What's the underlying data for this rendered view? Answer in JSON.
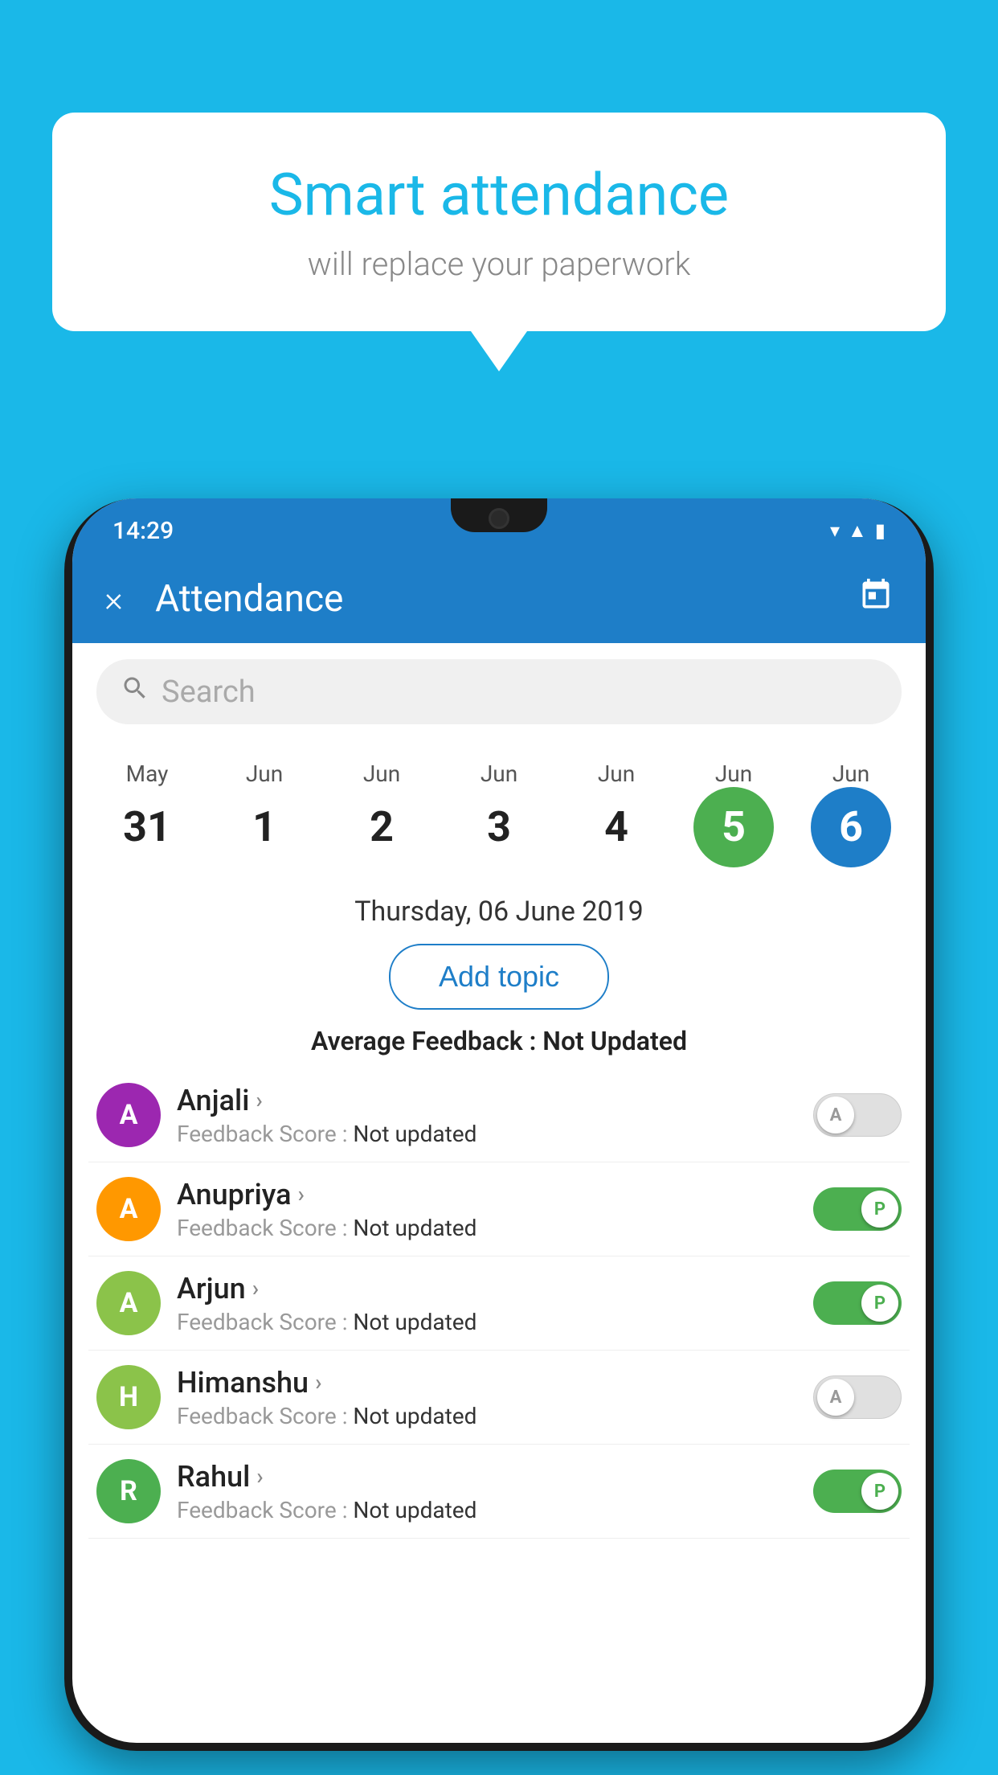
{
  "background_color": "#1ab8e8",
  "speech_bubble": {
    "title": "Smart attendance",
    "subtitle": "will replace your paperwork"
  },
  "status_bar": {
    "time": "14:29",
    "icons": [
      "wifi",
      "signal",
      "battery"
    ]
  },
  "app_header": {
    "title": "Attendance",
    "close_label": "×",
    "calendar_label": "📅"
  },
  "search": {
    "placeholder": "Search"
  },
  "dates": [
    {
      "month": "May",
      "day": "31",
      "state": "normal"
    },
    {
      "month": "Jun",
      "day": "1",
      "state": "normal"
    },
    {
      "month": "Jun",
      "day": "2",
      "state": "normal"
    },
    {
      "month": "Jun",
      "day": "3",
      "state": "normal"
    },
    {
      "month": "Jun",
      "day": "4",
      "state": "normal"
    },
    {
      "month": "Jun",
      "day": "5",
      "state": "today"
    },
    {
      "month": "Jun",
      "day": "6",
      "state": "selected"
    }
  ],
  "selected_date": "Thursday, 06 June 2019",
  "add_topic_label": "Add topic",
  "average_feedback_label": "Average Feedback :",
  "average_feedback_value": "Not Updated",
  "students": [
    {
      "name": "Anjali",
      "avatar_letter": "A",
      "avatar_color": "#9c27b0",
      "feedback_label": "Feedback Score :",
      "feedback_value": "Not updated",
      "toggle_state": "off",
      "toggle_label": "A"
    },
    {
      "name": "Anupriya",
      "avatar_letter": "A",
      "avatar_color": "#ff9800",
      "feedback_label": "Feedback Score :",
      "feedback_value": "Not updated",
      "toggle_state": "on",
      "toggle_label": "P"
    },
    {
      "name": "Arjun",
      "avatar_letter": "A",
      "avatar_color": "#8bc34a",
      "feedback_label": "Feedback Score :",
      "feedback_value": "Not updated",
      "toggle_state": "on",
      "toggle_label": "P"
    },
    {
      "name": "Himanshu",
      "avatar_letter": "H",
      "avatar_color": "#8bc34a",
      "feedback_label": "Feedback Score :",
      "feedback_value": "Not updated",
      "toggle_state": "off",
      "toggle_label": "A"
    },
    {
      "name": "Rahul",
      "avatar_letter": "R",
      "avatar_color": "#4caf50",
      "feedback_label": "Feedback Score :",
      "feedback_value": "Not updated",
      "toggle_state": "on",
      "toggle_label": "P"
    }
  ]
}
